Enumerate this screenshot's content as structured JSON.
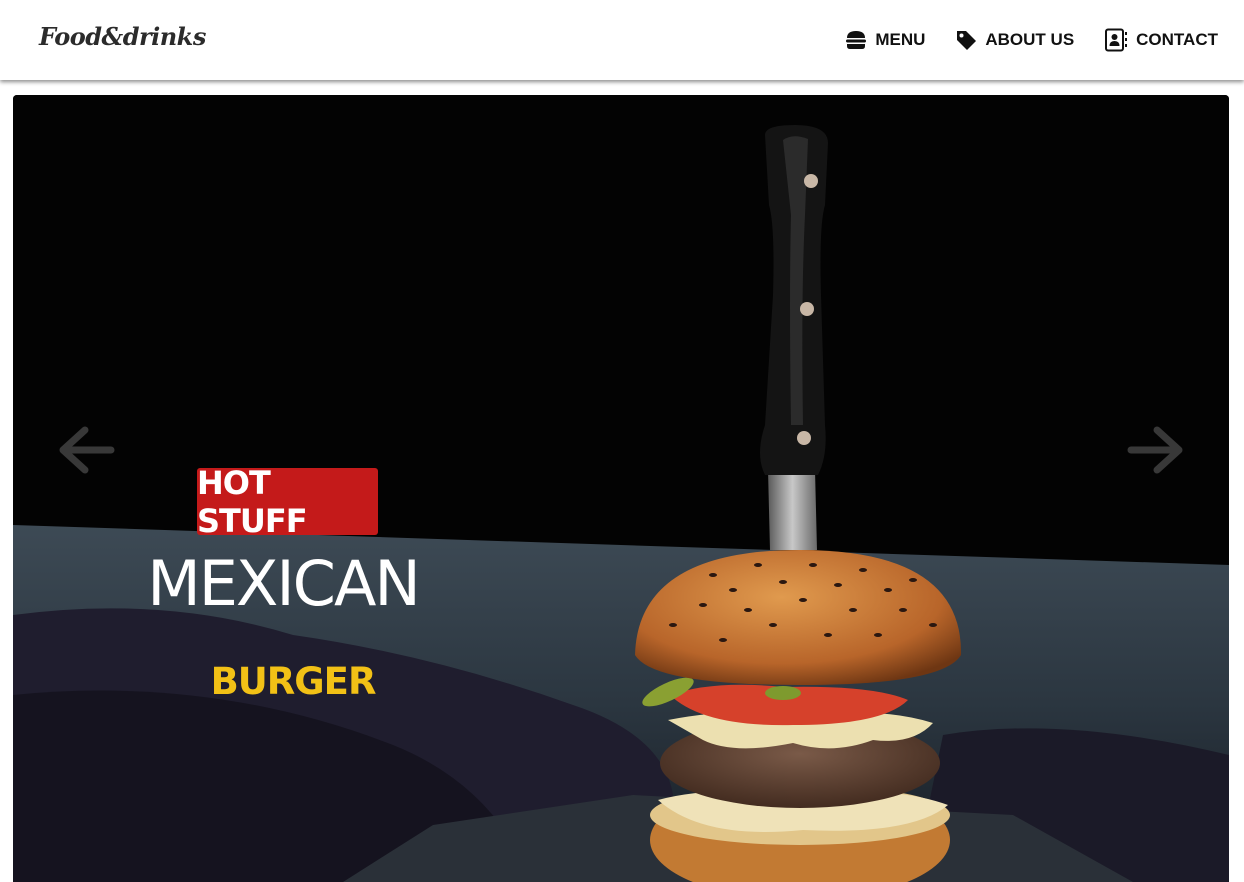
{
  "brand": {
    "logo_text": "Food&drinks"
  },
  "nav": {
    "items": [
      {
        "label": "MENU",
        "icon": "burger-icon"
      },
      {
        "label": "ABOUT US",
        "icon": "tag-icon"
      },
      {
        "label": "CONTACT",
        "icon": "contact-book-icon"
      }
    ]
  },
  "hero": {
    "badge": "HOT STUFF",
    "title": "MEXICAN",
    "subtitle": "BURGER",
    "prev_icon": "arrow-left-icon",
    "next_icon": "arrow-right-icon",
    "image": "burger-with-knife-photo"
  },
  "colors": {
    "badge_bg": "#c41a1a",
    "subtitle": "#f2c116",
    "nav_text": "#111111"
  }
}
